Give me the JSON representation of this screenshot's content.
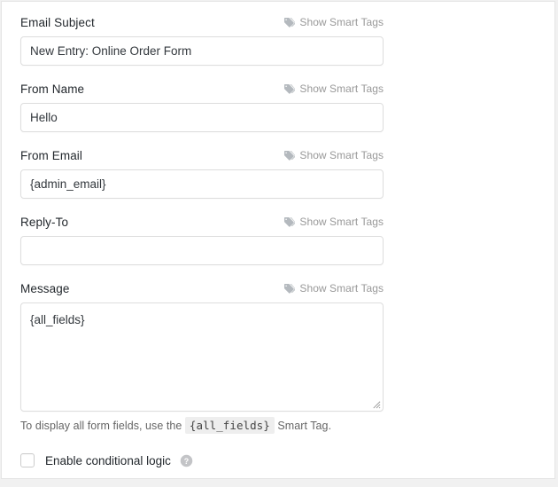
{
  "panel": {
    "smart_tags_link_label": "Show Smart Tags",
    "smart_tags_icon": "tag-icon",
    "fields": [
      {
        "key": "email_subject",
        "label": "Email Subject",
        "value": "New Entry: Online Order Form",
        "placeholder": ""
      },
      {
        "key": "from_name",
        "label": "From Name",
        "value": "Hello",
        "placeholder": ""
      },
      {
        "key": "from_email",
        "label": "From Email",
        "value": "{admin_email}",
        "placeholder": ""
      },
      {
        "key": "reply_to",
        "label": "Reply-To",
        "value": "",
        "placeholder": ""
      },
      {
        "key": "message",
        "label": "Message",
        "value": "{all_fields}",
        "placeholder": ""
      }
    ],
    "note": {
      "before": "To display all form fields, use the",
      "code": "{all_fields}",
      "after": "Smart Tag."
    },
    "conditional_logic": {
      "label": "Enable conditional logic",
      "checked": false,
      "help_icon": "help-circle-icon"
    }
  },
  "colors": {
    "page_background": "#f1f1f1",
    "panel_background": "#ffffff",
    "panel_border": "#e5e5e5",
    "input_border": "#dddddd",
    "label_text": "#23282d",
    "muted_text": "#999999",
    "note_text": "#666666",
    "code_chip_background": "#eeeeee"
  }
}
